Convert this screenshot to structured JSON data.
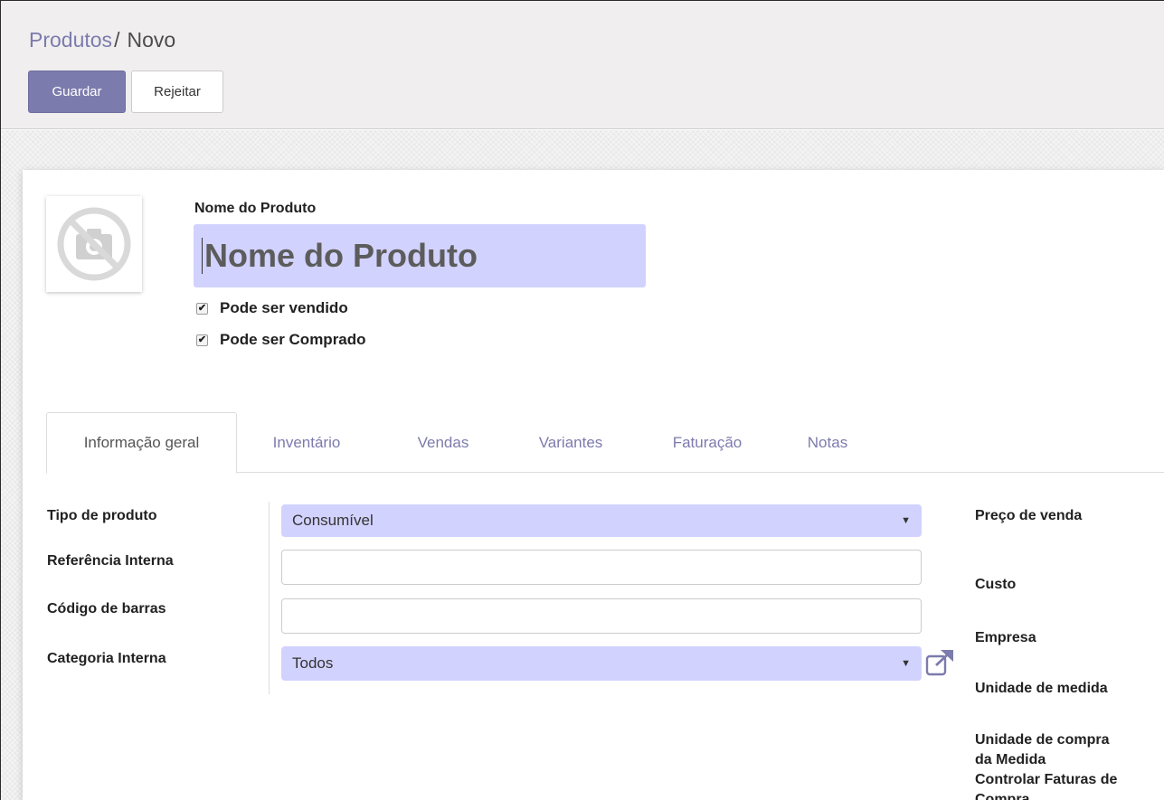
{
  "breadcrumb": {
    "parent": "Produtos",
    "separator": "/",
    "current": "Novo"
  },
  "buttons": {
    "save": "Guardar",
    "discard": "Rejeitar"
  },
  "product": {
    "name_label": "Nome do Produto",
    "name_placeholder": "Nome do Produto",
    "can_be_sold_label": "Pode ser vendido",
    "can_be_sold": true,
    "can_be_purchased_label": "Pode ser Comprado",
    "can_be_purchased": true,
    "checkmark": "✔"
  },
  "tabs": [
    {
      "label": "Informação geral",
      "active": true
    },
    {
      "label": "Inventário",
      "active": false
    },
    {
      "label": "Vendas",
      "active": false
    },
    {
      "label": "Variantes",
      "active": false
    },
    {
      "label": "Faturação",
      "active": false
    },
    {
      "label": "Notas",
      "active": false
    }
  ],
  "left_fields": {
    "product_type": {
      "label": "Tipo de produto",
      "value": "Consumível",
      "arrow": "▼"
    },
    "internal_ref": {
      "label": "Referência Interna",
      "value": ""
    },
    "barcode": {
      "label": "Código de barras",
      "value": ""
    },
    "category": {
      "label": "Categoria Interna",
      "value": "Todos",
      "arrow": "▼"
    }
  },
  "right_fields": {
    "sale_price": "Preço de venda",
    "cost": "Custo",
    "company": "Empresa",
    "uom": "Unidade de medida",
    "purchase_uom_line1": "Unidade de compra",
    "purchase_uom_line2": "da Medida",
    "bill_control_line1": "Controlar Faturas de",
    "bill_control_line2": "Compra"
  },
  "colors": {
    "brand": "#7c7bad",
    "input_highlight": "#d2d2ff",
    "control_panel": "#f0eeee"
  },
  "icons": {
    "image_placeholder": "camera-slash-icon",
    "external_link": "external-link-icon"
  }
}
